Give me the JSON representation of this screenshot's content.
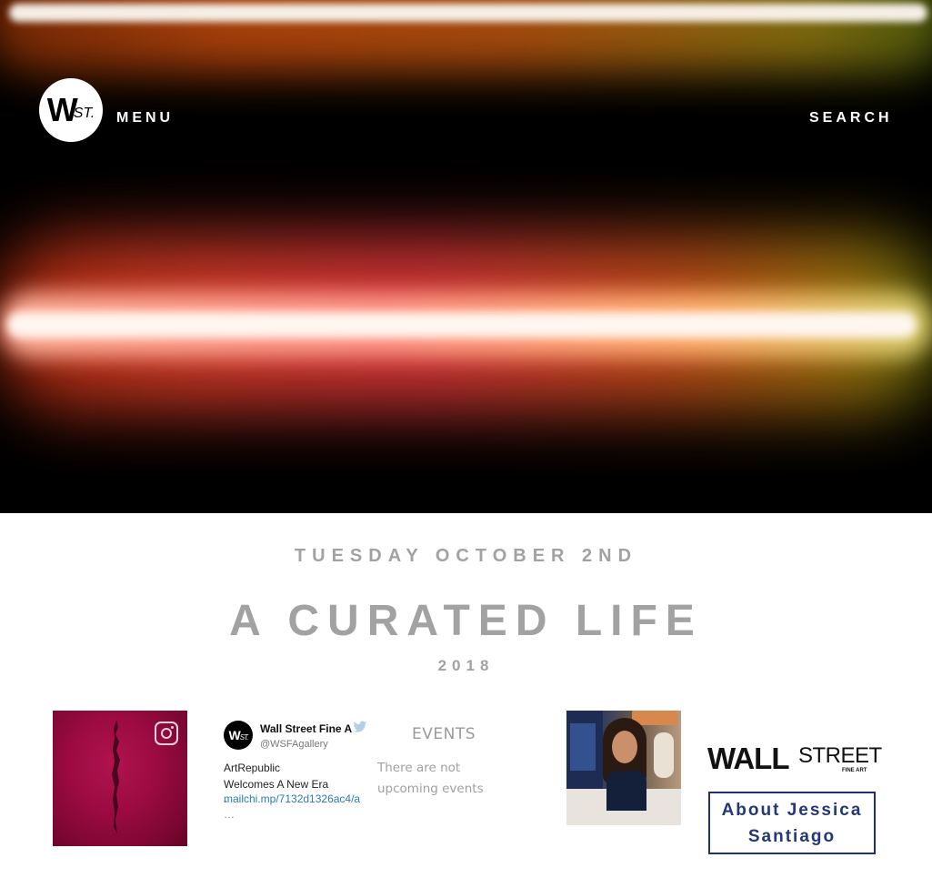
{
  "header": {
    "logo": {
      "main": "W",
      "sub": "ST."
    },
    "menu_label": "MENU",
    "search_label": "SEARCH"
  },
  "hero": {
    "date": "TUESDAY OCTOBER 2ND",
    "title": "A CURATED LIFE",
    "year": "2018"
  },
  "instagram": {
    "icon": "instagram-icon"
  },
  "twitter": {
    "avatar_main": "W",
    "avatar_sub": "ST.",
    "name": "Wall Street Fine A",
    "handle": "@WSFAgallery",
    "text": "ArtRepublic Welcomes A New Era  -",
    "link": "mailchi.mp/7132d1326ac4/a",
    "ellipsis": "…",
    "icon": "twitter-bird-icon"
  },
  "events": {
    "title": "EVENTS",
    "empty_text": "There are not upcoming events"
  },
  "sponsor": {
    "logo_wall": "WALL",
    "logo_street": "STREET",
    "logo_fine": "FINE ART",
    "button_label": "About Jessica Santiago"
  },
  "colors": {
    "heading_gray": "#a2a2a2",
    "button_border": "#1f2f72",
    "button_text": "#243777",
    "link": "#2b7bb9"
  }
}
